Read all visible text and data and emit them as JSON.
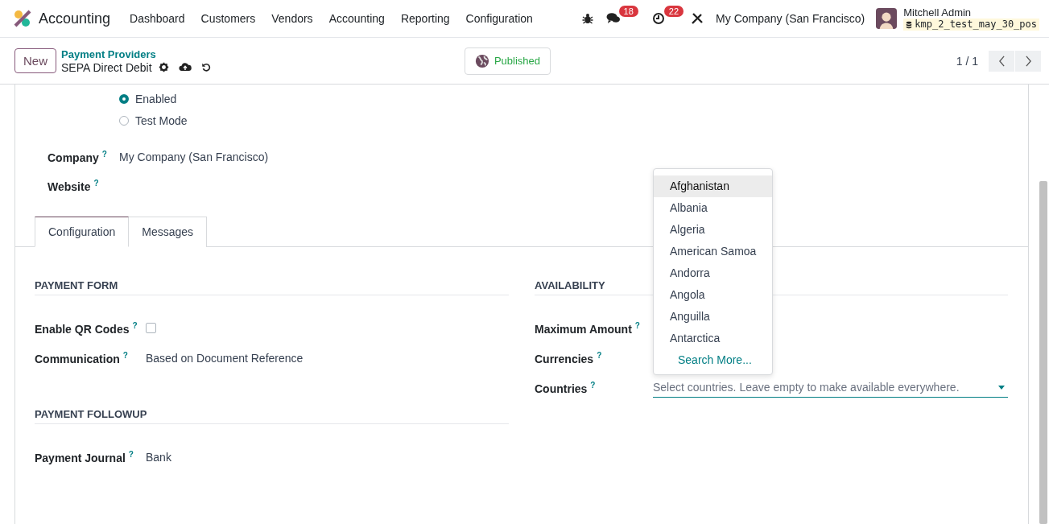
{
  "app": {
    "name": "Accounting"
  },
  "menu": [
    {
      "label": "Dashboard"
    },
    {
      "label": "Customers"
    },
    {
      "label": "Vendors"
    },
    {
      "label": "Accounting"
    },
    {
      "label": "Reporting"
    },
    {
      "label": "Configuration"
    }
  ],
  "systray": {
    "chat_count": "18",
    "activity_count": "22",
    "company": "My Company (San Francisco)",
    "user": "Mitchell Admin",
    "database": "kmp_2_test_may_30_pos"
  },
  "control_panel": {
    "new_button": "New",
    "breadcrumb": "Payment Providers",
    "record": "SEPA Direct Debit",
    "published": "Published",
    "pager": "1 / 1"
  },
  "state_options": [
    {
      "label": "Enabled",
      "selected": true
    },
    {
      "label": "Test Mode",
      "selected": false
    }
  ],
  "fields": [
    {
      "label": "Company",
      "help": "?",
      "value": "My Company (San Francisco)"
    },
    {
      "label": "Website",
      "help": "?"
    }
  ],
  "tabs": [
    {
      "label": "Configuration",
      "selected": true
    },
    {
      "label": "Messages",
      "selected": false
    }
  ],
  "payment_form": {
    "title": "PAYMENT FORM",
    "fields": [
      {
        "kind": "checkbox",
        "label": "Enable QR Codes",
        "help": "?",
        "checked": false
      },
      {
        "kind": "text",
        "label": "Communication",
        "help": "?",
        "value": "Based on Document Reference"
      }
    ]
  },
  "payment_followup": {
    "title": "PAYMENT FOLLOWUP",
    "fields": [
      {
        "kind": "text",
        "label": "Payment Journal",
        "help": "?",
        "value": "Bank"
      }
    ]
  },
  "availability": {
    "title": "AVAILABILITY",
    "fields": [
      {
        "kind": "text",
        "label": "Maximum Amount",
        "help": "?"
      },
      {
        "kind": "text",
        "label": "Currencies",
        "help": "?"
      },
      {
        "kind": "select",
        "label": "Countries",
        "help": "?",
        "placeholder": "Select countries. Leave empty to make available everywhere."
      }
    ]
  },
  "dropdown": {
    "items": [
      {
        "label": "Afghanistan",
        "selected": true
      },
      {
        "label": "Albania",
        "selected": false
      },
      {
        "label": "Algeria",
        "selected": false
      },
      {
        "label": "American Samoa",
        "selected": false
      },
      {
        "label": "Andorra",
        "selected": false
      },
      {
        "label": "Angola",
        "selected": false
      },
      {
        "label": "Anguilla",
        "selected": false
      },
      {
        "label": "Antarctica",
        "selected": false
      }
    ],
    "search_more": "Search More..."
  }
}
